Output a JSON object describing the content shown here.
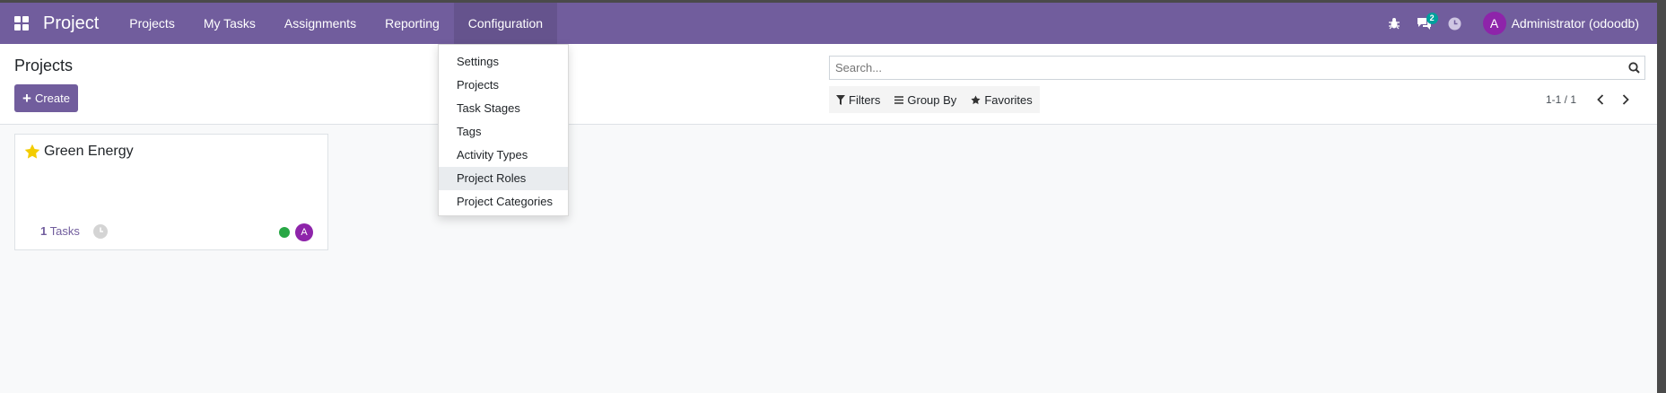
{
  "navbar": {
    "brand": "Project",
    "menu": [
      {
        "label": "Projects"
      },
      {
        "label": "My Tasks"
      },
      {
        "label": "Assignments"
      },
      {
        "label": "Reporting"
      },
      {
        "label": "Configuration"
      }
    ],
    "messages_count": "2",
    "user_initial": "A",
    "user_name": "Administrator (odoodb)"
  },
  "control_panel": {
    "title": "Projects",
    "create_label": "Create",
    "search_placeholder": "Search...",
    "filters_label": "Filters",
    "group_by_label": "Group By",
    "favorites_label": "Favorites",
    "pager_value": "1-1 / 1"
  },
  "configuration_menu": {
    "items": [
      {
        "label": "Settings"
      },
      {
        "label": "Projects"
      },
      {
        "label": "Task Stages"
      },
      {
        "label": "Tags"
      },
      {
        "label": "Activity Types"
      },
      {
        "label": "Project Roles"
      },
      {
        "label": "Project Categories"
      }
    ]
  },
  "projects": [
    {
      "name": "Green Energy",
      "task_count": "1",
      "tasks_label": "Tasks",
      "favorite": true,
      "status_color": "#28a745",
      "assignee_initial": "A"
    }
  ],
  "colors": {
    "navbar": "#715d9d",
    "accent": "#715d9d",
    "badge": "#00a09d",
    "avatar": "#8e24aa",
    "favorite_star": "#f3cc00"
  }
}
